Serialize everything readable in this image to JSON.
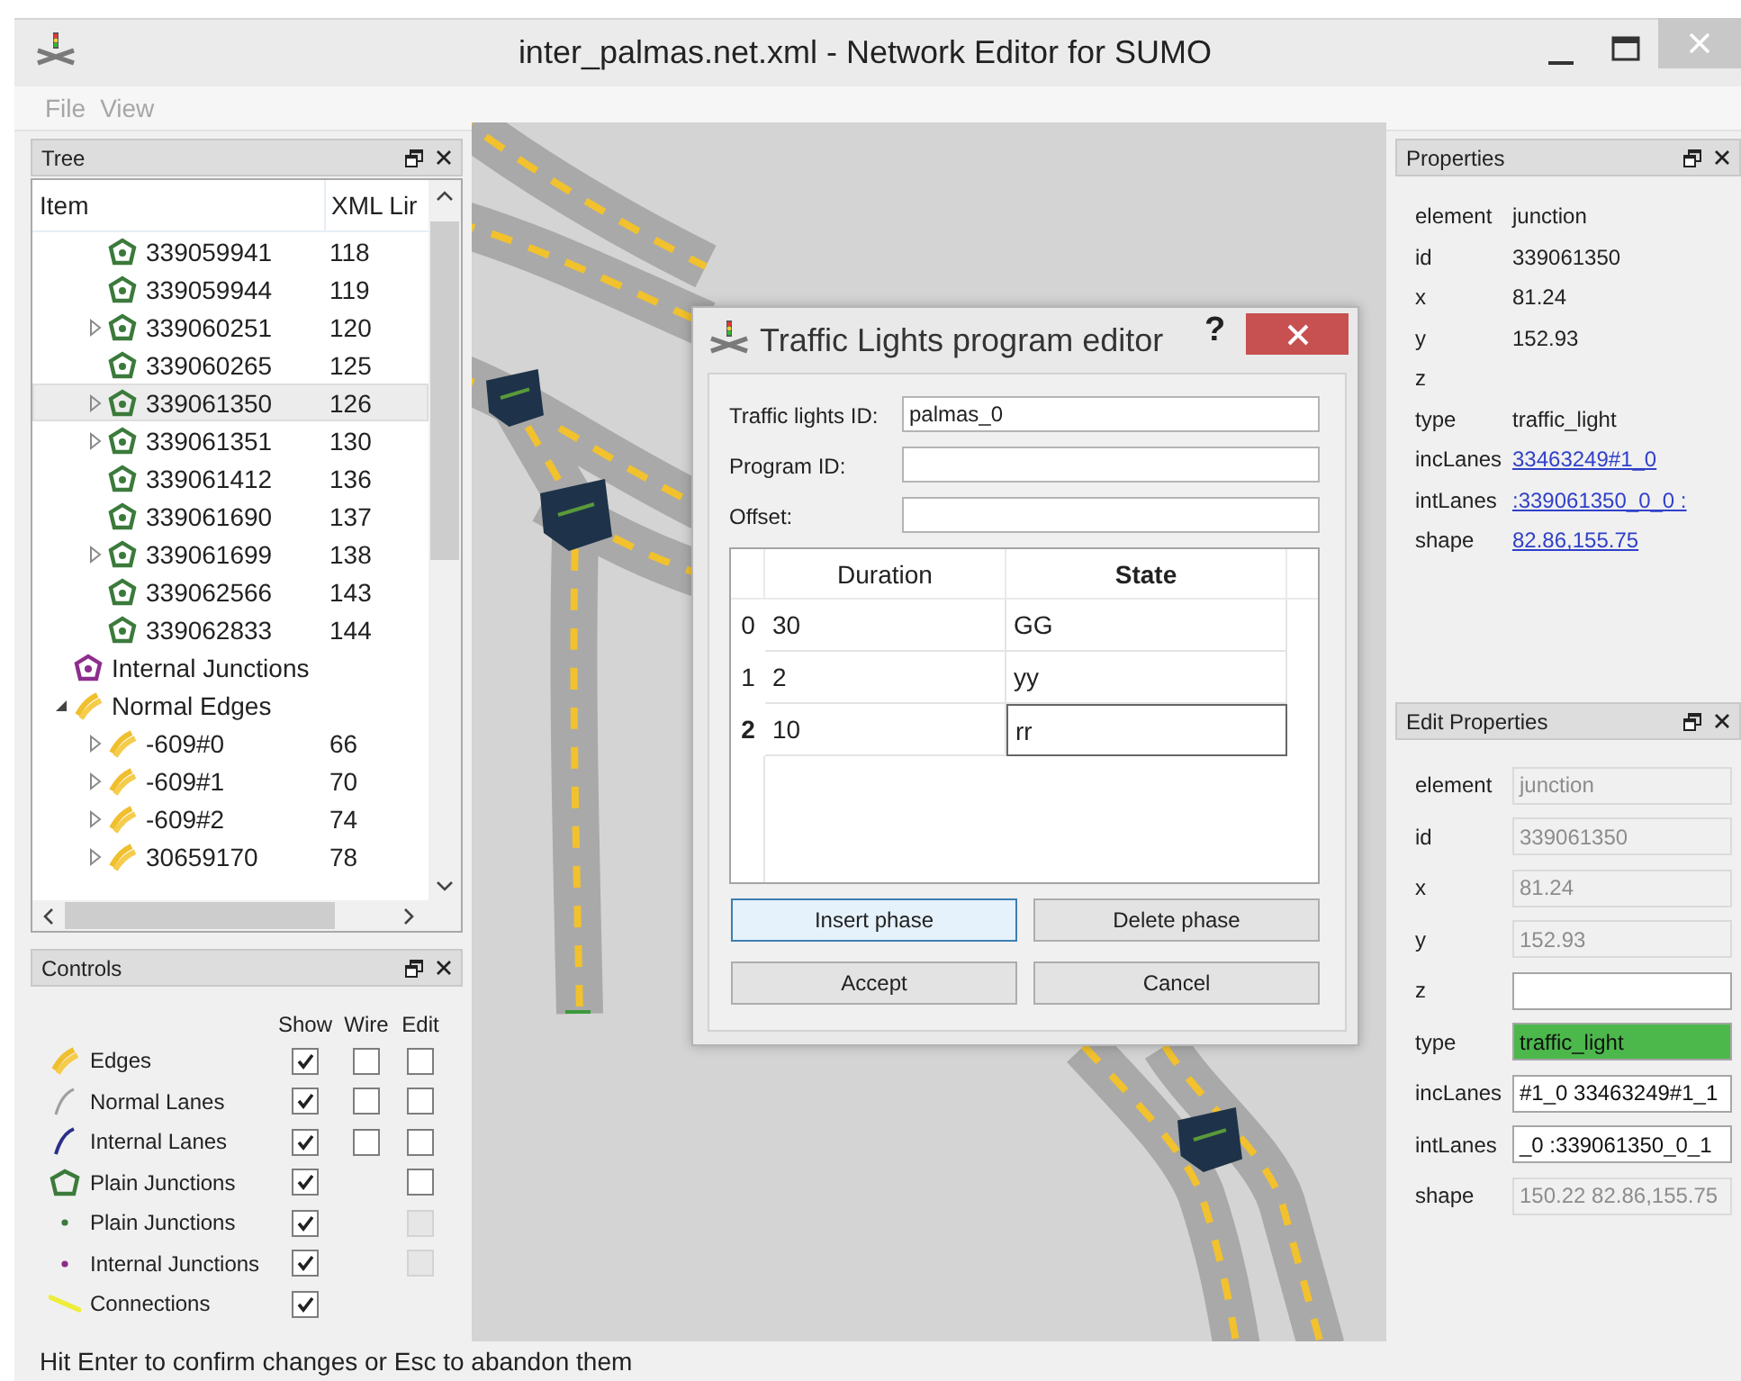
{
  "window": {
    "title": "inter_palmas.net.xml - Network Editor for SUMO"
  },
  "menu": [
    {
      "label": "File",
      "disabled": true
    },
    {
      "label": "View",
      "disabled": true
    }
  ],
  "tree": {
    "title": "Tree",
    "columns": [
      "Item",
      "XML Lir"
    ],
    "items": [
      {
        "kind": "continued",
        "children": [
          {
            "kind": "junction",
            "label": "339059941",
            "line": "118",
            "has_children": false,
            "selected": false
          },
          {
            "kind": "junction",
            "label": "339059944",
            "line": "119",
            "has_children": false,
            "selected": false
          },
          {
            "kind": "junction",
            "label": "339060251",
            "line": "120",
            "has_children": true,
            "expanded": false,
            "selected": false
          },
          {
            "kind": "junction",
            "label": "339060265",
            "line": "125",
            "has_children": false,
            "selected": false
          },
          {
            "kind": "junction",
            "label": "339061350",
            "line": "126",
            "has_children": true,
            "expanded": false,
            "selected": true
          },
          {
            "kind": "junction",
            "label": "339061351",
            "line": "130",
            "has_children": true,
            "expanded": false,
            "selected": false
          },
          {
            "kind": "junction",
            "label": "339061412",
            "line": "136",
            "has_children": false,
            "selected": false
          },
          {
            "kind": "junction",
            "label": "339061690",
            "line": "137",
            "has_children": false,
            "selected": false
          },
          {
            "kind": "junction",
            "label": "339061699",
            "line": "138",
            "has_children": true,
            "expanded": false,
            "selected": false
          },
          {
            "kind": "junction",
            "label": "339062566",
            "line": "143",
            "has_children": false,
            "selected": false
          },
          {
            "kind": "junction",
            "label": "339062833",
            "line": "144",
            "has_children": false,
            "selected": false
          }
        ]
      },
      {
        "kind": "internal_junctions",
        "label": "Internal Junctions",
        "has_children": false,
        "selected": false
      },
      {
        "kind": "edges",
        "label": "Normal Edges",
        "has_children": true,
        "expanded": true,
        "selected": false,
        "children": [
          {
            "kind": "edge",
            "label": "-609#0",
            "line": "66",
            "has_children": true,
            "expanded": false,
            "selected": false
          },
          {
            "kind": "edge",
            "label": "-609#1",
            "line": "70",
            "has_children": true,
            "expanded": false,
            "selected": false
          },
          {
            "kind": "edge",
            "label": "-609#2",
            "line": "74",
            "has_children": true,
            "expanded": false,
            "selected": false
          },
          {
            "kind": "edge",
            "label": "30659170",
            "line": "78",
            "has_children": true,
            "expanded": false,
            "selected": false
          }
        ]
      }
    ]
  },
  "controls": {
    "title": "Controls",
    "columns": [
      "Show",
      "Wire",
      "Edit"
    ],
    "rows": [
      {
        "kind": "edge",
        "label": "Edges",
        "show": true,
        "wire": false,
        "edit": false,
        "edit_disabled": false
      },
      {
        "kind": "normal_lane",
        "label": "Normal Lanes",
        "show": true,
        "wire": false,
        "edit": false,
        "edit_disabled": false
      },
      {
        "kind": "internal_lane",
        "label": "Internal Lanes",
        "show": true,
        "wire": false,
        "edit": false,
        "edit_disabled": false
      },
      {
        "kind": "junction_outline",
        "label": "Plain Junctions",
        "show": true,
        "edit": false,
        "edit_disabled": false
      },
      {
        "kind": "junction_dot",
        "label": "Plain Junctions",
        "show": true,
        "edit": false,
        "edit_disabled": true
      },
      {
        "kind": "internal_junction_dot",
        "label": "Internal Junctions",
        "show": true,
        "edit": false,
        "edit_disabled": true
      },
      {
        "kind": "connection",
        "label": "Connections",
        "show": true
      }
    ]
  },
  "properties": {
    "title": "Properties",
    "rows": [
      {
        "key": "element",
        "value": "junction",
        "link": false
      },
      {
        "key": "id",
        "value": "339061350",
        "link": false
      },
      {
        "key": "x",
        "value": "81.24",
        "link": false
      },
      {
        "key": "y",
        "value": "152.93",
        "link": false
      },
      {
        "key": "z"
      },
      {
        "key": "type",
        "value": "traffic_light",
        "link": false
      },
      {
        "key": "incLanes",
        "value": "33463249#1_0",
        "link": true
      },
      {
        "key": "intLanes",
        "value": ":339061350_0_0 :",
        "link": true
      },
      {
        "key": "shape",
        "value": "82.86,155.75",
        "link": true
      }
    ]
  },
  "edit_properties": {
    "title": "Edit Properties",
    "rows": [
      {
        "key": "element",
        "value": "junction",
        "editable": false,
        "highlight": false
      },
      {
        "key": "id",
        "value": "339061350",
        "editable": false,
        "highlight": false
      },
      {
        "key": "x",
        "value": "81.24",
        "editable": false,
        "highlight": false
      },
      {
        "key": "y",
        "value": "152.93",
        "editable": false,
        "highlight": false
      },
      {
        "key": "z",
        "editable": true,
        "highlight": false
      },
      {
        "key": "type",
        "value": "traffic_light",
        "editable": true,
        "highlight": true
      },
      {
        "key": "incLanes",
        "value": "#1_0 33463249#1_1",
        "editable": true,
        "highlight": false
      },
      {
        "key": "intLanes",
        "value": "_0 :339061350_0_1",
        "editable": true,
        "highlight": false
      },
      {
        "key": "shape",
        "value": "150.22 82.86,155.75",
        "editable": false,
        "highlight": false
      }
    ]
  },
  "dialog": {
    "title": "Traffic Lights program editor",
    "help": "?",
    "fields": [
      {
        "label": "Traffic lights ID:",
        "value": "palmas_0"
      },
      {
        "label": "Program ID:"
      },
      {
        "label": "Offset:"
      }
    ],
    "table": {
      "columns": [
        {
          "label": "Duration",
          "current": false
        },
        {
          "label": "State",
          "current": true
        }
      ],
      "rows": [
        {
          "header": "0",
          "current": false,
          "cells": [
            "30",
            "GG"
          ]
        },
        {
          "header": "1",
          "current": false,
          "cells": [
            "2",
            "yy"
          ]
        },
        {
          "header": "2",
          "current": true,
          "cells": [
            "10",
            "rr"
          ]
        }
      ]
    },
    "buttons": [
      {
        "label": "Insert phase",
        "focused": true
      },
      {
        "label": "Delete phase",
        "focused": false
      },
      {
        "label": "Accept",
        "focused": false
      },
      {
        "label": "Cancel",
        "focused": false
      }
    ]
  },
  "status_bar": "Hit Enter to confirm changes or Esc to abandon them"
}
